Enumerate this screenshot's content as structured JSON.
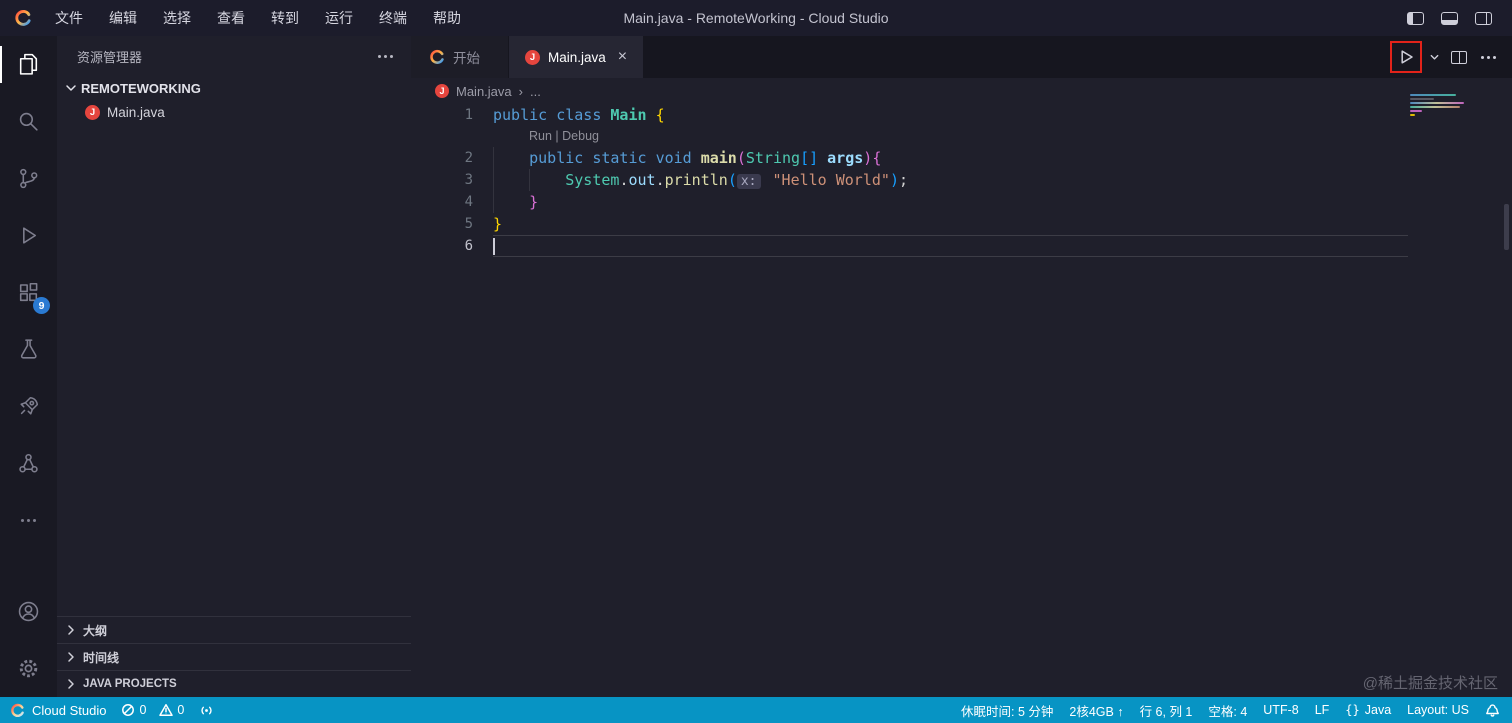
{
  "colors": {
    "status_bar": "#0794c4",
    "annotation_red": "#e2231a",
    "extensions_badge_bg": "#2a7ad2",
    "java_icon_bg": "#e5453e"
  },
  "icons": [
    "cloud-studio-logo",
    "files-icon",
    "search-icon",
    "source-control-icon",
    "run-debug-icon",
    "extensions-icon",
    "testing-icon",
    "rocket-icon",
    "cluster-icon",
    "more-icon",
    "account-icon",
    "settings-gear-icon",
    "ellipsis-icon",
    "chevron-down-icon",
    "chevron-right-icon",
    "java-file-icon",
    "close-icon",
    "play-icon",
    "split-editor-icon",
    "layout-left-icon",
    "layout-bottom-icon",
    "layout-right-icon",
    "error-icon",
    "warning-icon",
    "ports-icon",
    "braces-icon",
    "bell-icon"
  ],
  "title_bar": {
    "menus": [
      "文件",
      "编辑",
      "选择",
      "查看",
      "转到",
      "运行",
      "终端",
      "帮助"
    ],
    "title": "Main.java - RemoteWorking - Cloud Studio"
  },
  "activity_bar": {
    "extensions_badge": "9"
  },
  "sidebar": {
    "title": "资源管理器",
    "tree": {
      "root": "REMOTEWORKING",
      "file": "Main.java"
    },
    "sections": [
      {
        "label": "大纲"
      },
      {
        "label": "时间线"
      },
      {
        "label": "JAVA PROJECTS"
      }
    ]
  },
  "icons_text": {
    "java_badge": "J"
  },
  "editor": {
    "tabs": [
      {
        "label": "开始",
        "active": false
      },
      {
        "label": "Main.java",
        "active": true,
        "close": "×"
      }
    ],
    "breadcrumb": {
      "file": "Main.java",
      "separator": "›",
      "more": "..."
    },
    "codelens": {
      "run": "Run",
      "separator": "|",
      "debug": "Debug"
    },
    "code": {
      "token_colors": {
        "kw": "#569cd6",
        "type": "#4ec9b0",
        "fn": "#dcdcaa",
        "var": "#9cdcfe",
        "str": "#ce9178",
        "b1": "#ffd700",
        "b2": "#da70d6",
        "b3": "#179fff",
        "pl": "#d4d4d4"
      },
      "inlay_hint": "x:",
      "lines": [
        {
          "num": "1",
          "indent": 0,
          "tokens": [
            {
              "t": "public",
              "c": "kw"
            },
            {
              "t": " "
            },
            {
              "t": "class",
              "c": "kw"
            },
            {
              "t": " "
            },
            {
              "t": "Main",
              "c": "type",
              "b": true
            },
            {
              "t": " "
            },
            {
              "t": "{",
              "c": "b1"
            }
          ]
        },
        {
          "num": "2",
          "indent": 4,
          "tokens": [
            {
              "t": "public",
              "c": "kw"
            },
            {
              "t": " "
            },
            {
              "t": "static",
              "c": "kw"
            },
            {
              "t": " "
            },
            {
              "t": "void",
              "c": "kw"
            },
            {
              "t": " "
            },
            {
              "t": "main",
              "c": "fn",
              "b": true
            },
            {
              "t": "(",
              "c": "b2"
            },
            {
              "t": "String",
              "c": "type"
            },
            {
              "t": "[]",
              "c": "b3"
            },
            {
              "t": " "
            },
            {
              "t": "args",
              "c": "var",
              "b": true
            },
            {
              "t": ")",
              "c": "b2"
            },
            {
              "t": "{",
              "c": "b2"
            }
          ]
        },
        {
          "num": "3",
          "indent": 8,
          "tokens": [
            {
              "t": "System",
              "c": "type"
            },
            {
              "t": ".",
              "c": "pl"
            },
            {
              "t": "out",
              "c": "var"
            },
            {
              "t": ".",
              "c": "pl"
            },
            {
              "t": "println",
              "c": "fn"
            },
            {
              "t": "(",
              "c": "b3"
            },
            {
              "hint": true
            },
            {
              "t": " "
            },
            {
              "t": "\"Hello World\"",
              "c": "str"
            },
            {
              "t": ")",
              "c": "b3"
            },
            {
              "t": ";",
              "c": "pl"
            }
          ]
        },
        {
          "num": "4",
          "indent": 4,
          "tokens": [
            {
              "t": "}",
              "c": "b2"
            }
          ]
        },
        {
          "num": "5",
          "indent": 0,
          "tokens": [
            {
              "t": "}",
              "c": "b1"
            }
          ]
        },
        {
          "num": "6",
          "indent": 0,
          "current": true,
          "tokens": []
        }
      ]
    }
  },
  "status_bar": {
    "brand": "Cloud Studio",
    "errors": "0",
    "warnings": "0",
    "items_right": [
      {
        "label": "休眠时间: 5 分钟"
      },
      {
        "label": "2核4GB ↑"
      },
      {
        "label": "行 6, 列 1"
      },
      {
        "label": "空格: 4"
      },
      {
        "label": "UTF-8"
      },
      {
        "label": "LF"
      },
      {
        "icon": "{}",
        "label": "Java"
      },
      {
        "label": "Layout: US"
      }
    ]
  },
  "watermark": "@稀土掘金技术社区"
}
